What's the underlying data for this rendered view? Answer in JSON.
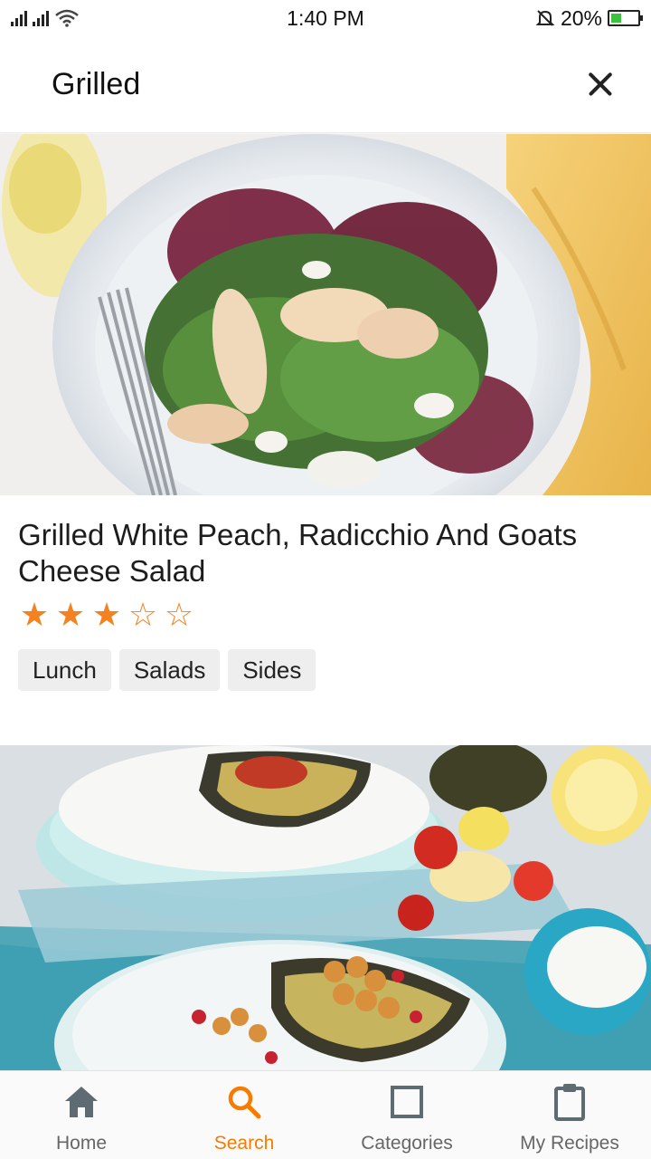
{
  "status_bar": {
    "time": "1:40 PM",
    "battery": "20%"
  },
  "header": {
    "search_query": "Grilled",
    "close_icon": "close-icon"
  },
  "recipes": [
    {
      "title": "Grilled White Peach, Radicchio And Goats Cheese Salad",
      "rating": 3,
      "max_rating": 5,
      "tags": [
        "Lunch",
        "Salads",
        "Sides"
      ]
    },
    {
      "title": "",
      "tags": []
    }
  ],
  "bottom_nav": {
    "items": [
      {
        "label": "Home",
        "icon": "home-icon",
        "active": false
      },
      {
        "label": "Search",
        "icon": "search-icon",
        "active": true
      },
      {
        "label": "Categories",
        "icon": "square-icon",
        "active": false
      },
      {
        "label": "My Recipes",
        "icon": "clipboard-icon",
        "active": false
      }
    ]
  },
  "colors": {
    "accent": "#f57c00",
    "star": "#f58220",
    "inactive_nav": "#666666",
    "tag_bg": "#eeeeee"
  }
}
